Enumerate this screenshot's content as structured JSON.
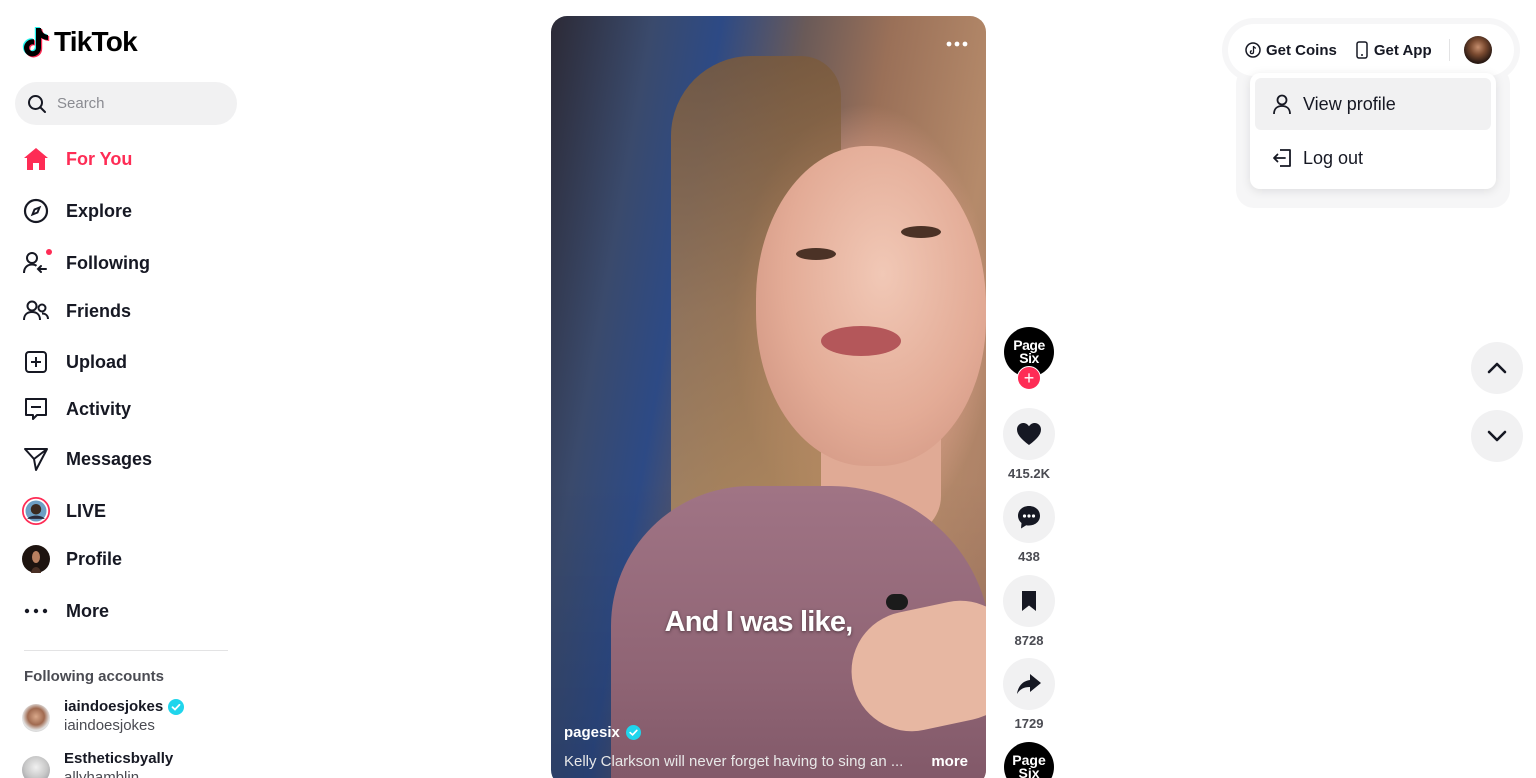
{
  "app": {
    "logo_text": "TikTok"
  },
  "search": {
    "placeholder": "Search"
  },
  "sidebar": {
    "items": [
      {
        "label": "For You",
        "icon": "home-icon",
        "active": true
      },
      {
        "label": "Explore",
        "icon": "compass-icon"
      },
      {
        "label": "Following",
        "icon": "following-icon",
        "badge_dot": true
      },
      {
        "label": "Friends",
        "icon": "friends-icon"
      },
      {
        "label": "Upload",
        "icon": "upload-icon"
      },
      {
        "label": "Activity",
        "icon": "activity-icon"
      },
      {
        "label": "Messages",
        "icon": "messages-icon"
      },
      {
        "label": "LIVE",
        "icon": "live-avatar-icon"
      },
      {
        "label": "Profile",
        "icon": "profile-avatar-icon"
      },
      {
        "label": "More",
        "icon": "more-icon"
      }
    ],
    "following_title": "Following accounts",
    "accounts": [
      {
        "username": "iaindoesjokes",
        "nickname": "iaindoesjokes",
        "verified": true
      },
      {
        "username": "Estheticsbyally",
        "nickname": "allyhamblin",
        "verified": false
      }
    ]
  },
  "video": {
    "caption_text": "And I was like,",
    "author": "pagesix",
    "author_verified": true,
    "description": "Kelly Clarkson will never forget having to sing an ...",
    "more_label": "more",
    "options_icon": "ellipsis-icon"
  },
  "actions": {
    "creator_logo": "Page Six",
    "likes": "415.2K",
    "comments": "438",
    "saves": "8728",
    "shares": "1729"
  },
  "topbar": {
    "get_coins": "Get Coins",
    "get_app": "Get App"
  },
  "profile_menu": {
    "items": [
      {
        "label": "View profile",
        "icon": "person-icon"
      },
      {
        "label": "Log out",
        "icon": "logout-icon"
      }
    ]
  },
  "colors": {
    "accent": "#fe2c55",
    "verified": "#20d5ec"
  }
}
